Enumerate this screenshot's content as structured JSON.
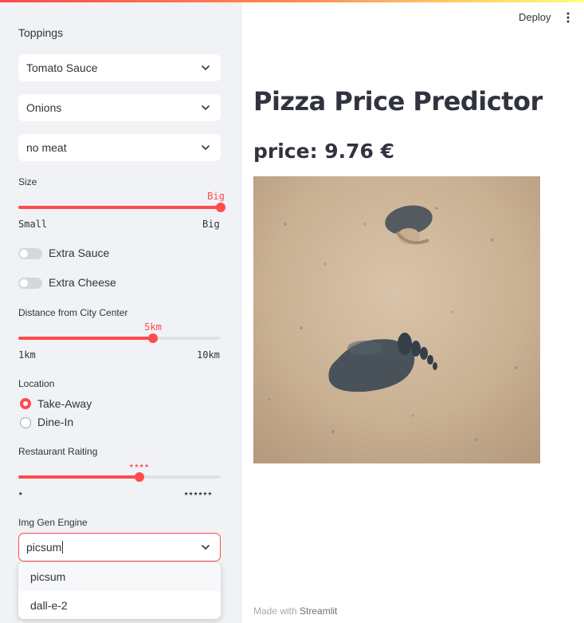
{
  "header": {
    "deploy_label": "Deploy",
    "menu_icon": "kebab-menu-icon"
  },
  "sidebar": {
    "toppings_label": "Toppings",
    "topping_selects": [
      {
        "value": "Tomato Sauce"
      },
      {
        "value": "Onions"
      },
      {
        "value": "no meat"
      }
    ],
    "size": {
      "label": "Size",
      "value": "Big",
      "min_label": "Small",
      "max_label": "Big",
      "fraction": 1.0
    },
    "toggles": [
      {
        "label": "Extra Sauce",
        "on": false
      },
      {
        "label": "Extra Cheese",
        "on": false
      }
    ],
    "distance": {
      "label": "Distance from City Center",
      "value": "5km",
      "min_label": "1km",
      "max_label": "10km",
      "fraction": 0.667
    },
    "location": {
      "label": "Location",
      "options": [
        {
          "label": "Take-Away",
          "selected": true
        },
        {
          "label": "Dine-In",
          "selected": false
        }
      ]
    },
    "rating": {
      "label": "Restaurant Raiting",
      "value": "★★★★",
      "min_label": "★",
      "max_label": "★★★★★★",
      "fraction": 0.6
    },
    "img_engine": {
      "label": "Img Gen Engine",
      "value": "picsum",
      "options": [
        "picsum",
        "dall-e-2"
      ]
    }
  },
  "main": {
    "title": "Pizza Price Predictor",
    "price_text": "price: 9.76 €",
    "image_desc": "footprints-in-sand-photo"
  },
  "footer": {
    "made_with": "Made with",
    "brand": "Streamlit"
  },
  "colors": {
    "accent": "#ff4b4b",
    "sidebar_bg": "#f0f2f6",
    "text": "#31333f"
  }
}
